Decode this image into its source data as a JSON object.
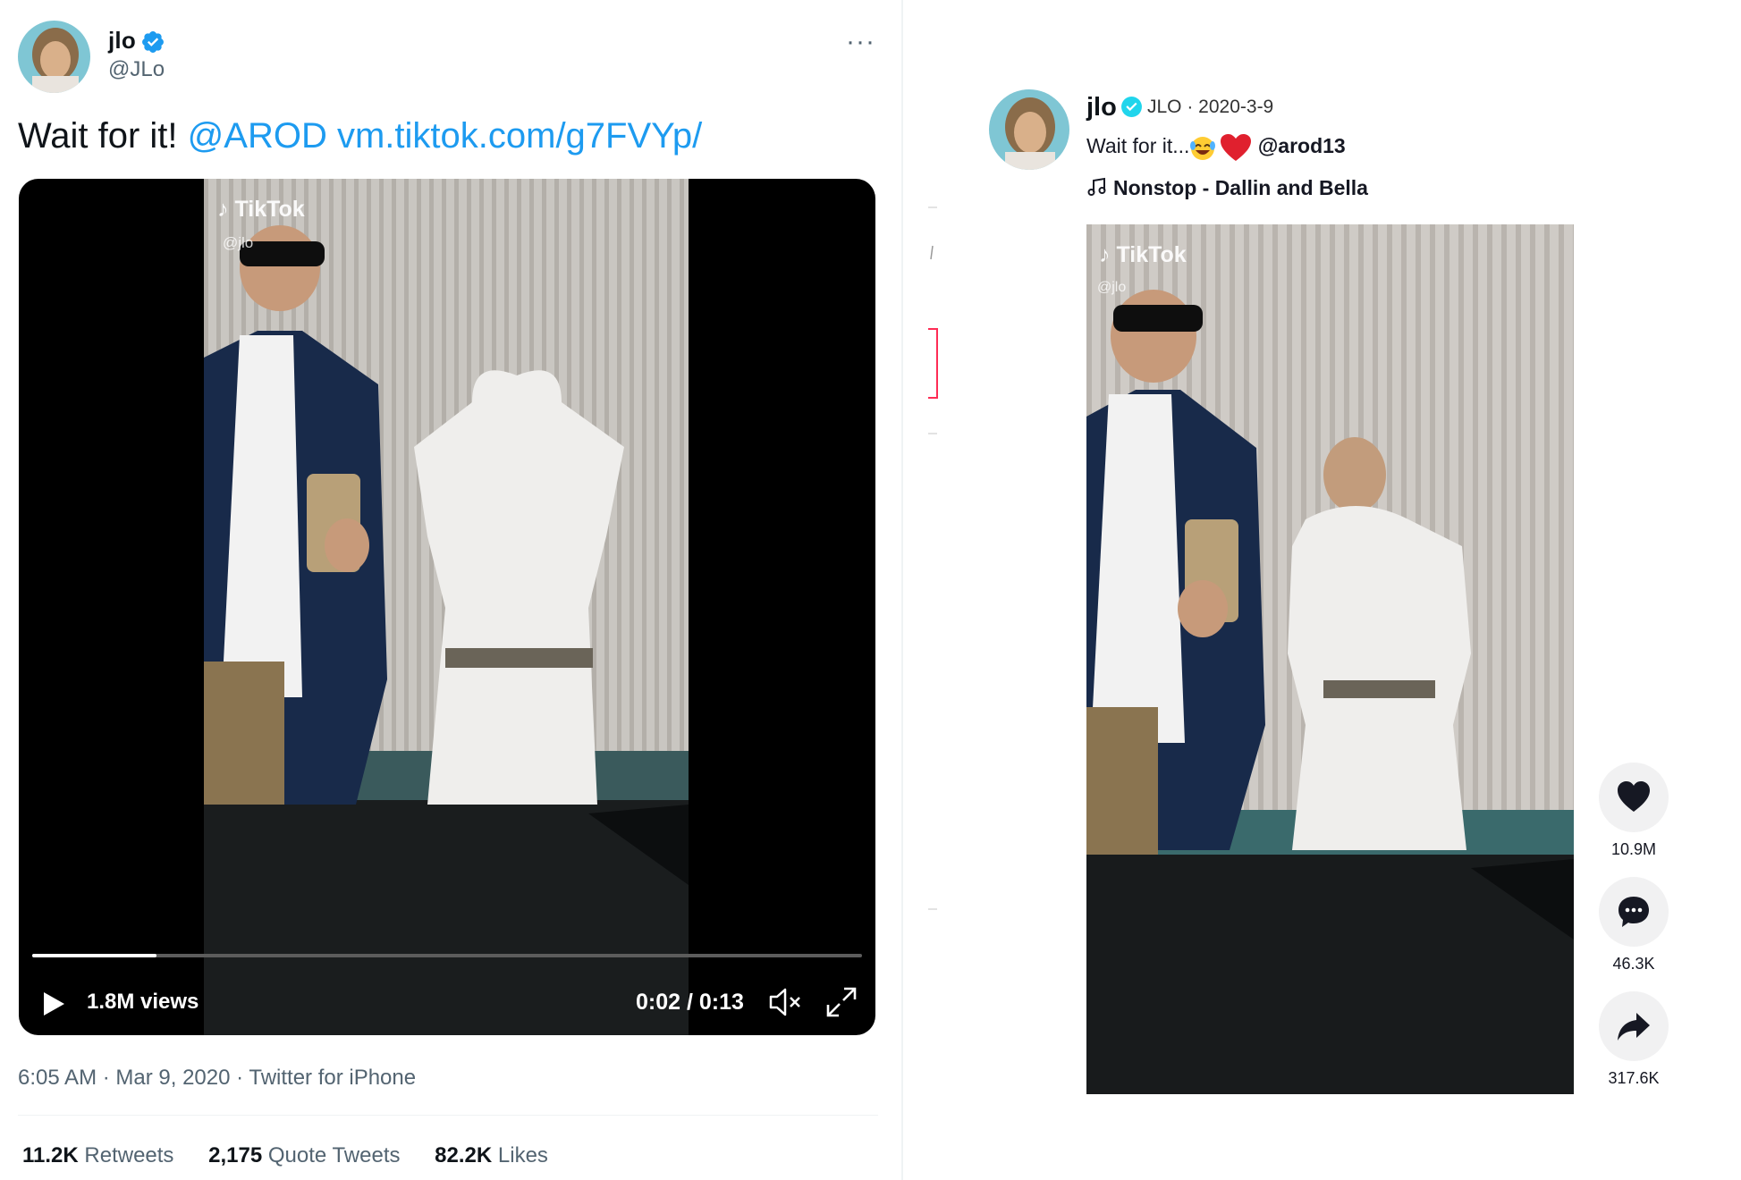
{
  "twitter": {
    "display_name": "jlo",
    "handle": "@JLo",
    "more_label": "···",
    "tweet_text_plain": "Wait for it!",
    "tweet_mention": "@AROD",
    "tweet_link": "vm.tiktok.com/g7FVYp/",
    "video": {
      "watermark_brand": "TikTok",
      "watermark_user": "@jlo",
      "progress": 0.15,
      "views": "1.8M views",
      "time": "0:02 / 0:13"
    },
    "timestamp": "6:05 AM · Mar 9, 2020 · Twitter for iPhone",
    "stats": {
      "retweets_count": "11.2K",
      "retweets_label": "Retweets",
      "quotes_count": "2,175",
      "quotes_label": "Quote Tweets",
      "likes_count": "82.2K",
      "likes_label": "Likes"
    },
    "colors": {
      "link": "#1d9bf0",
      "verified": "#1d9bf0"
    }
  },
  "tiktok": {
    "display_name": "jlo",
    "nickname_date": "JLO · 2020-3-9",
    "caption_text": "Wait for it...",
    "caption_mention": "@arod13",
    "music": "Nonstop - Dallin and Bella",
    "video": {
      "watermark_brand": "TikTok",
      "watermark_user": "@jlo"
    },
    "actions": {
      "likes": "10.9M",
      "comments": "46.3K",
      "shares": "317.6K"
    },
    "colors": {
      "verified": "#20d5ec",
      "heart": "#fe2c55"
    }
  }
}
